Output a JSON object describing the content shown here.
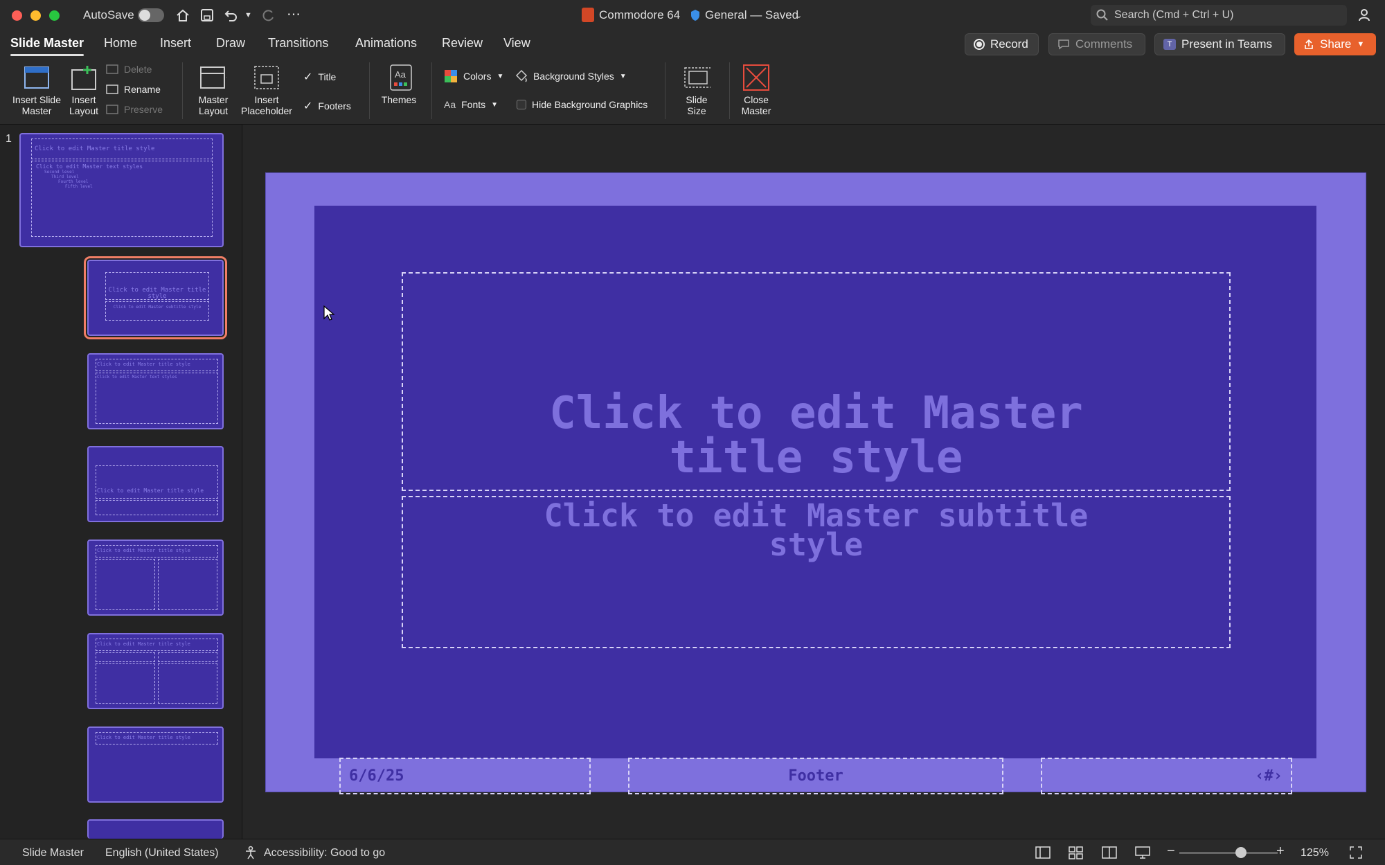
{
  "window": {
    "autosave_label": "AutoSave",
    "doc_title": "Commodore 64",
    "saved_status": "General — Saved",
    "search_placeholder": "Search (Cmd + Ctrl + U)"
  },
  "tabs": [
    "Slide Master",
    "Home",
    "Insert",
    "Draw",
    "Transitions",
    "Animations",
    "Review",
    "View"
  ],
  "actions": {
    "record": "Record",
    "comments": "Comments",
    "present": "Present in Teams",
    "share": "Share"
  },
  "ribbon": {
    "insert_slide_master": [
      "Insert Slide",
      "Master"
    ],
    "insert_layout": [
      "Insert",
      "Layout"
    ],
    "delete": "Delete",
    "rename": "Rename",
    "preserve": "Preserve",
    "master_layout": [
      "Master",
      "Layout"
    ],
    "insert_placeholder": [
      "Insert",
      "Placeholder"
    ],
    "title_check": "Title",
    "footers_check": "Footers",
    "themes": "Themes",
    "colors": "Colors",
    "fonts": "Fonts",
    "background_styles": "Background Styles",
    "hide_background_graphics": "Hide Background Graphics",
    "slide_size": [
      "Slide",
      "Size"
    ],
    "close_master": [
      "Close",
      "Master"
    ]
  },
  "thumbs": {
    "slide_number": "1",
    "master_title": "Click to edit Master title style",
    "master_text": "Click to edit Master text styles",
    "level2": "Second level",
    "level3": "Third level",
    "level4": "Fourth level",
    "level5": "Fifth level",
    "subtitle": "Click to edit Master subtitle style"
  },
  "slide": {
    "title_line1": "Click to edit Master",
    "title_line2": "title style",
    "subtitle_line1": "Click to edit Master subtitle",
    "subtitle_line2": "style",
    "date": "6/6/25",
    "footer": "Footer",
    "page_number": "‹#›"
  },
  "status": {
    "view": "Slide Master",
    "language": "English (United States)",
    "accessibility": "Accessibility: Good to go",
    "zoom": "125%",
    "zoom_level": 0.63
  },
  "colors": {
    "slide_outer": "#7e70dd",
    "slide_inner": "#3f2fa3",
    "accent_share": "#e8612c",
    "selection": "#f07e66"
  }
}
